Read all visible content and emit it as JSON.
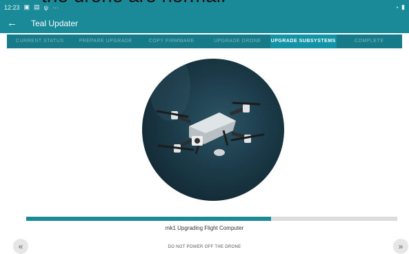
{
  "overlay_caption": "the drone are normal.",
  "status_bar": {
    "time": "12:23",
    "right_icons": [
      "wifi-icon",
      "battery-icon"
    ]
  },
  "app_bar": {
    "title": "Teal Updater"
  },
  "steps": [
    {
      "label": "CURRENT STATUS",
      "active": false
    },
    {
      "label": "PREPARE UPGRADE",
      "active": false
    },
    {
      "label": "COPY FIRMWARE",
      "active": false
    },
    {
      "label": "UPGRADE DRONE",
      "active": false
    },
    {
      "label": "UPGRADE SUBSYSTEMS",
      "active": true
    },
    {
      "label": "COMPLETE",
      "active": false
    }
  ],
  "progress": {
    "fraction": 0.66,
    "label": "mk1 Upgrading Flight Computer"
  },
  "warning": "DO NOT POWER OFF THE DRONE",
  "nav": {
    "prev_label": "«",
    "next_label": "»"
  },
  "colors": {
    "primary": "#1a8a99",
    "steps_bg": "#167a88",
    "step_active": "#1393a6"
  }
}
